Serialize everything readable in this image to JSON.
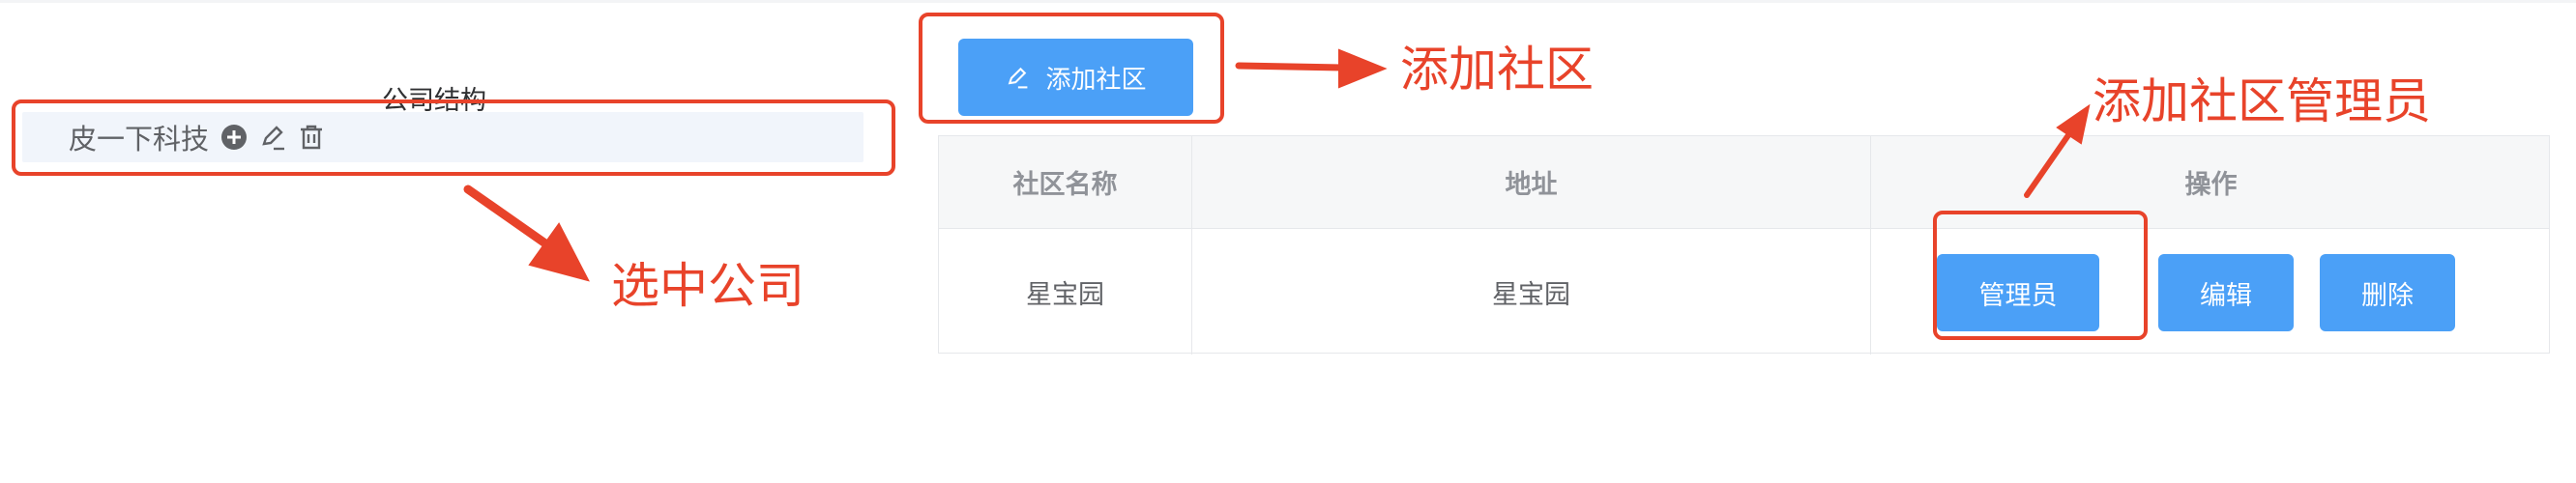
{
  "tree": {
    "title": "公司结构",
    "node": {
      "label": "皮一下科技",
      "icons": [
        "plus-circle-icon",
        "edit-icon",
        "delete-icon"
      ]
    }
  },
  "toolbar": {
    "add_label": "添加社区",
    "add_icon": "edit-icon"
  },
  "table": {
    "headers": [
      "社区名称",
      "地址",
      "操作"
    ],
    "rows": [
      {
        "name": "星宝园",
        "address": "星宝园",
        "actions": [
          "管理员",
          "编辑",
          "删除"
        ]
      }
    ]
  },
  "annotations": {
    "select_company": "选中公司",
    "add_community": "添加社区",
    "add_admin": "添加社区管理员",
    "color": "#e8432a"
  },
  "colors": {
    "primary": "#4ba0f7",
    "node_bg": "#f1f5fb",
    "header_bg": "#f6f7f8"
  }
}
